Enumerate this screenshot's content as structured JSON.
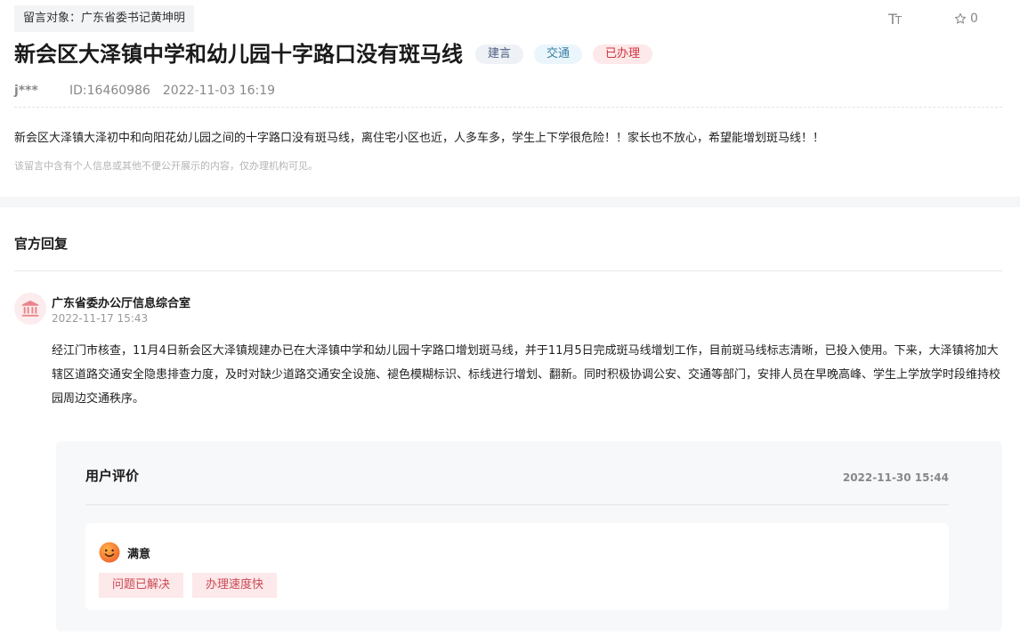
{
  "header": {
    "target_label": "留言对象：广东省委书记黄坤明",
    "font_size_icon": "text-size-icon",
    "favorite_count": "0",
    "title": "新会区大泽镇中学和幼儿园十字路口没有斑马线",
    "badges": [
      "建言",
      "交通",
      "已办理"
    ]
  },
  "meta": {
    "user": "j***",
    "message_id": "ID:16460986",
    "datetime": "2022-11-03 16:19"
  },
  "message": {
    "content": "新会区大泽镇大泽初中和向阳花幼儿园之间的十字路口没有斑马线，离住宅小区也近，人多车多，学生上下学很危险！！家长也不放心，希望能增划斑马线！！",
    "privacy_note": "该留言中含有个人信息或其他不便公开展示的内容，仅办理机构可见。"
  },
  "reply": {
    "section_title": "官方回复",
    "org_name": "广东省委办公厅信息综合室",
    "time": "2022-11-17 15:43",
    "body": "经江门市核查，11月4日新会区大泽镇规建办已在大泽镇中学和幼儿园十字路口增划斑马线，并于11月5日完成斑马线增划工作，目前斑马线标志清晰，已投入使用。下来，大泽镇将加大辖区道路交通安全隐患排查力度，及时对缺少道路交通安全设施、褪色模糊标识、标线进行增划、翻新。同时积极协调公安、交通等部门，安排人员在早晚高峰、学生上学放学时段维持校园周边交通秩序。"
  },
  "evaluation": {
    "title": "用户评价",
    "date": "2022-11-30 15:44",
    "satisfaction": "满意",
    "tags": [
      "问题已解决",
      "办理速度快"
    ]
  },
  "colors": {
    "accent_red": "#d0343f",
    "badge_suggest_bg": "#eef1f6",
    "badge_traffic_bg": "#eaf6fb",
    "badge_done_bg": "#fde8ea"
  }
}
